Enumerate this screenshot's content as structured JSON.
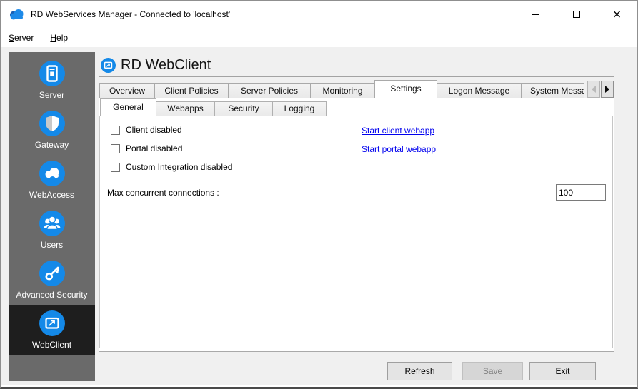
{
  "window": {
    "title": "RD WebServices Manager - Connected to 'localhost'",
    "controls": [
      {
        "name": "minimize",
        "icon": "minimize-icon"
      },
      {
        "name": "maximize",
        "icon": "maximize-icon"
      },
      {
        "name": "close",
        "icon": "close-icon"
      }
    ]
  },
  "menu": {
    "items": [
      {
        "mnemonic": "S",
        "rest": "erver"
      },
      {
        "mnemonic": "H",
        "rest": "elp"
      }
    ]
  },
  "sidebar": {
    "items": [
      {
        "label": "Server",
        "icon": "server-icon",
        "selected": false
      },
      {
        "label": "Gateway",
        "icon": "shield-icon",
        "selected": false
      },
      {
        "label": "WebAccess",
        "icon": "cloud-icon",
        "selected": false
      },
      {
        "label": "Users",
        "icon": "users-icon",
        "selected": false
      },
      {
        "label": "Advanced Security",
        "icon": "key-icon",
        "selected": false
      },
      {
        "label": "WebClient",
        "icon": "monitor-icon",
        "selected": true
      }
    ]
  },
  "main": {
    "page_title": "RD WebClient",
    "page_icon": "monitor-icon",
    "primary_tabs": [
      {
        "label": "Overview",
        "active": false
      },
      {
        "label": "Client Policies",
        "active": false
      },
      {
        "label": "Server Policies",
        "active": false
      },
      {
        "label": "Monitoring",
        "active": false
      },
      {
        "label": "Settings",
        "active": true
      },
      {
        "label": "Logon Message",
        "active": false
      },
      {
        "label": "System Messa",
        "active": false,
        "truncated": true
      }
    ],
    "tab_scroll": [
      {
        "icon": "scroll-left-icon",
        "enabled": false
      },
      {
        "icon": "scroll-right-icon",
        "enabled": true
      }
    ],
    "secondary_tabs": [
      {
        "label": "General",
        "active": true
      },
      {
        "label": "Webapps",
        "active": false
      },
      {
        "label": "Security",
        "active": false
      },
      {
        "label": "Logging",
        "active": false
      }
    ],
    "general": {
      "rows": [
        {
          "checkbox": "Client disabled",
          "checked": false,
          "link": "Start client webapp"
        },
        {
          "checkbox": "Portal disabled",
          "checked": false,
          "link": "Start portal webapp"
        },
        {
          "checkbox": "Custom Integration disabled",
          "checked": false,
          "link": ""
        }
      ],
      "max_connections_label": "Max concurrent connections :",
      "max_connections_value": "100"
    },
    "footer_buttons": [
      {
        "label": "Refresh",
        "enabled": true
      },
      {
        "label": "Save",
        "enabled": false
      },
      {
        "label": "Exit",
        "enabled": true
      }
    ]
  },
  "colors": {
    "accent_blue": "#1489e8",
    "sidebar_gray": "#6a6a6a",
    "sidebar_selected": "#1e1e1e",
    "link_blue": "#0000EE",
    "window_bg": "#f0f0f0",
    "page_bg": "#ffffff"
  }
}
